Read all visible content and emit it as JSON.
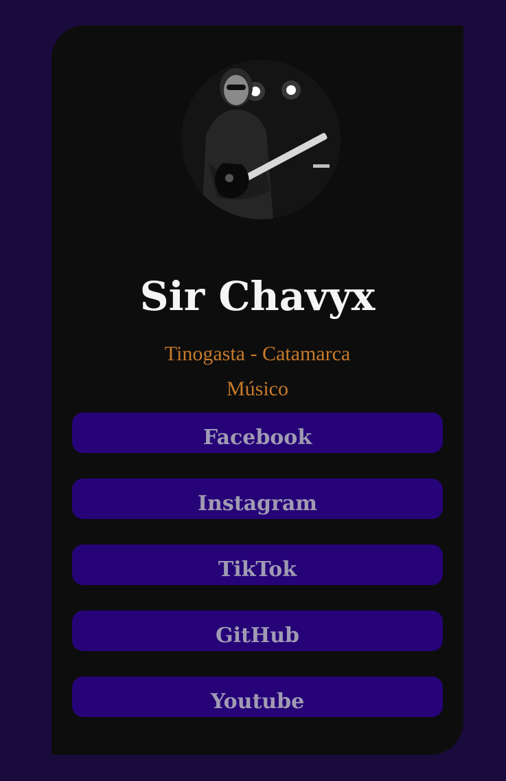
{
  "profile": {
    "name": "Sir Chavyx",
    "location": "Tinogasta - Catamarca",
    "role": "Músico",
    "avatar_icon": "guitarist-photo"
  },
  "links": [
    {
      "label": "Facebook"
    },
    {
      "label": "Instagram"
    },
    {
      "label": "TikTok"
    },
    {
      "label": "GitHub"
    },
    {
      "label": "Youtube"
    }
  ],
  "colors": {
    "page_background": "#1a0b3d",
    "card_background": "#0d0d0d",
    "name_text": "#f4f4f4",
    "subtitle_text": "#c77a2b",
    "button_background": "#260478",
    "button_text": "#a09bb3"
  }
}
